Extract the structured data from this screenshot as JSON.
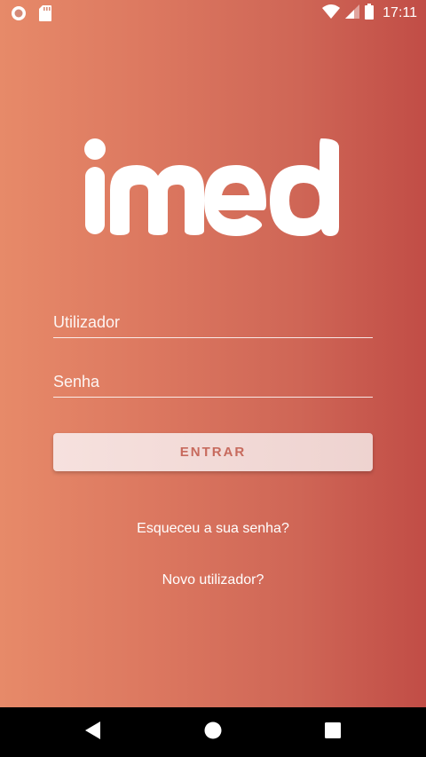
{
  "status_bar": {
    "time": "17:11",
    "icons": [
      "notification-circle-icon",
      "sd-card-icon",
      "wifi-icon",
      "cellular-signal-icon",
      "battery-icon"
    ]
  },
  "logo": {
    "text": "imed",
    "color": "#ffffff"
  },
  "login": {
    "username_placeholder": "Utilizador",
    "username_value": "",
    "password_placeholder": "Senha",
    "password_value": "",
    "submit_label": "ENTRAR",
    "forgot_password_label": "Esqueceu a sua senha?",
    "new_user_label": "Novo utilizador?"
  },
  "colors": {
    "gradient_left": "#e78a69",
    "gradient_right": "#c14d46",
    "button_text": "#c76a5d",
    "button_bg": "#f3dcd9"
  },
  "nav_bar": {
    "icons": [
      "back-icon",
      "home-icon",
      "recents-icon"
    ]
  }
}
